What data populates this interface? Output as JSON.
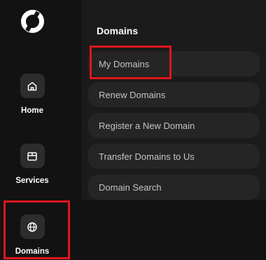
{
  "sidebar": {
    "logo_icon": "ring-logo-icon",
    "items": [
      {
        "label": "Home",
        "icon": "home-icon"
      },
      {
        "label": "Services",
        "icon": "box-icon"
      },
      {
        "label": "Domains",
        "icon": "globe-icon"
      }
    ]
  },
  "panel": {
    "title": "Domains",
    "items": [
      {
        "label": "My Domains"
      },
      {
        "label": "Renew Domains"
      },
      {
        "label": "Register a New Domain"
      },
      {
        "label": "Transfer Domains to Us"
      },
      {
        "label": "Domain Search"
      }
    ]
  },
  "colors": {
    "background": "#121212",
    "panel": "#1b1b1b",
    "menu_item": "#252525",
    "highlight": "#e0161b"
  }
}
